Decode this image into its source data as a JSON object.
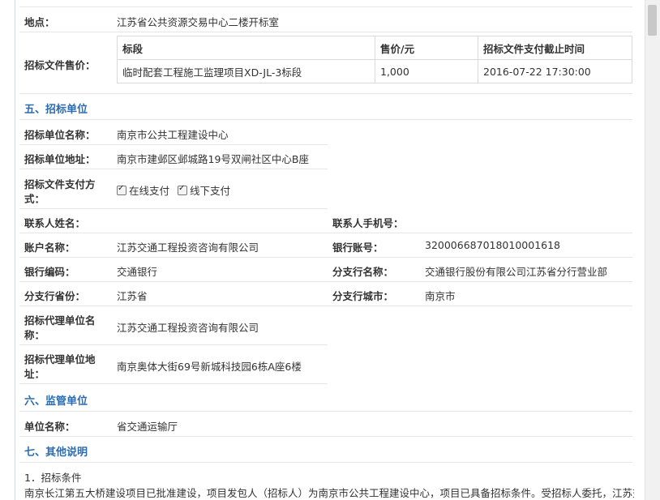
{
  "location": {
    "label": "地点：",
    "value": "江苏省公共资源交易中心二楼开标室"
  },
  "fee": {
    "label": "招标文件售价：",
    "headers": [
      "标段",
      "售价/元",
      "招标文件支付截止时间"
    ],
    "rows": [
      [
        "临时配套工程施工监理项目XD-JL-3标段",
        "1,000",
        "2016-07-22 17:30:00"
      ]
    ]
  },
  "section5": {
    "title": "五、招标单位",
    "unit_name": {
      "label": "招标单位名称：",
      "value": "南京市公共工程建设中心"
    },
    "unit_address": {
      "label": "招标单位地址：",
      "value": "南京市建邺区邺城路19号双闸社区中心B座"
    },
    "payment": {
      "label_line1": "招标文件支付方",
      "label_line2": "式：",
      "online": "在线支付",
      "offline": "线下支付"
    },
    "contact_name": {
      "label": "联系人姓名：",
      "value": ""
    },
    "contact_phone": {
      "label": "联系人手机号：",
      "value": ""
    },
    "account_name": {
      "label": "账户名称：",
      "value": "江苏交通工程投资咨询有限公司"
    },
    "bank_account": {
      "label": "银行账号：",
      "value": "32000668701801000161­8"
    },
    "bank_code": {
      "label": "银行编码：",
      "value": "交通银行"
    },
    "branch_name": {
      "label": "分支行名称：",
      "value": "交通银行股份有限公司江苏省分行营业部"
    },
    "branch_province": {
      "label": "分支行省份：",
      "value": "江苏省"
    },
    "branch_city": {
      "label": "分支行城市：",
      "value": "南京市"
    },
    "agent_name": {
      "label_line1": "招标代理单位名",
      "label_line2": "称：",
      "value": "江苏交通工程投资咨询有限公司"
    },
    "agent_address": {
      "label_line1": "招标代理单位地",
      "label_line2": "址：",
      "value": "南京奥体大街69号新城科技园6栋A座6楼"
    }
  },
  "section6": {
    "title": "六、监管单位",
    "unit_name": {
      "label": "单位名称：",
      "value": "省交通运输厅"
    }
  },
  "section7": {
    "title": "七、其他说明",
    "item1": "1．招标条件",
    "para1": "南京长江第五大桥建设项目已批准建设，项目发包人（招标人）为南京市公共工程建设中心，项目已具备招标条件。受招标人委托，江苏交通"
  }
}
